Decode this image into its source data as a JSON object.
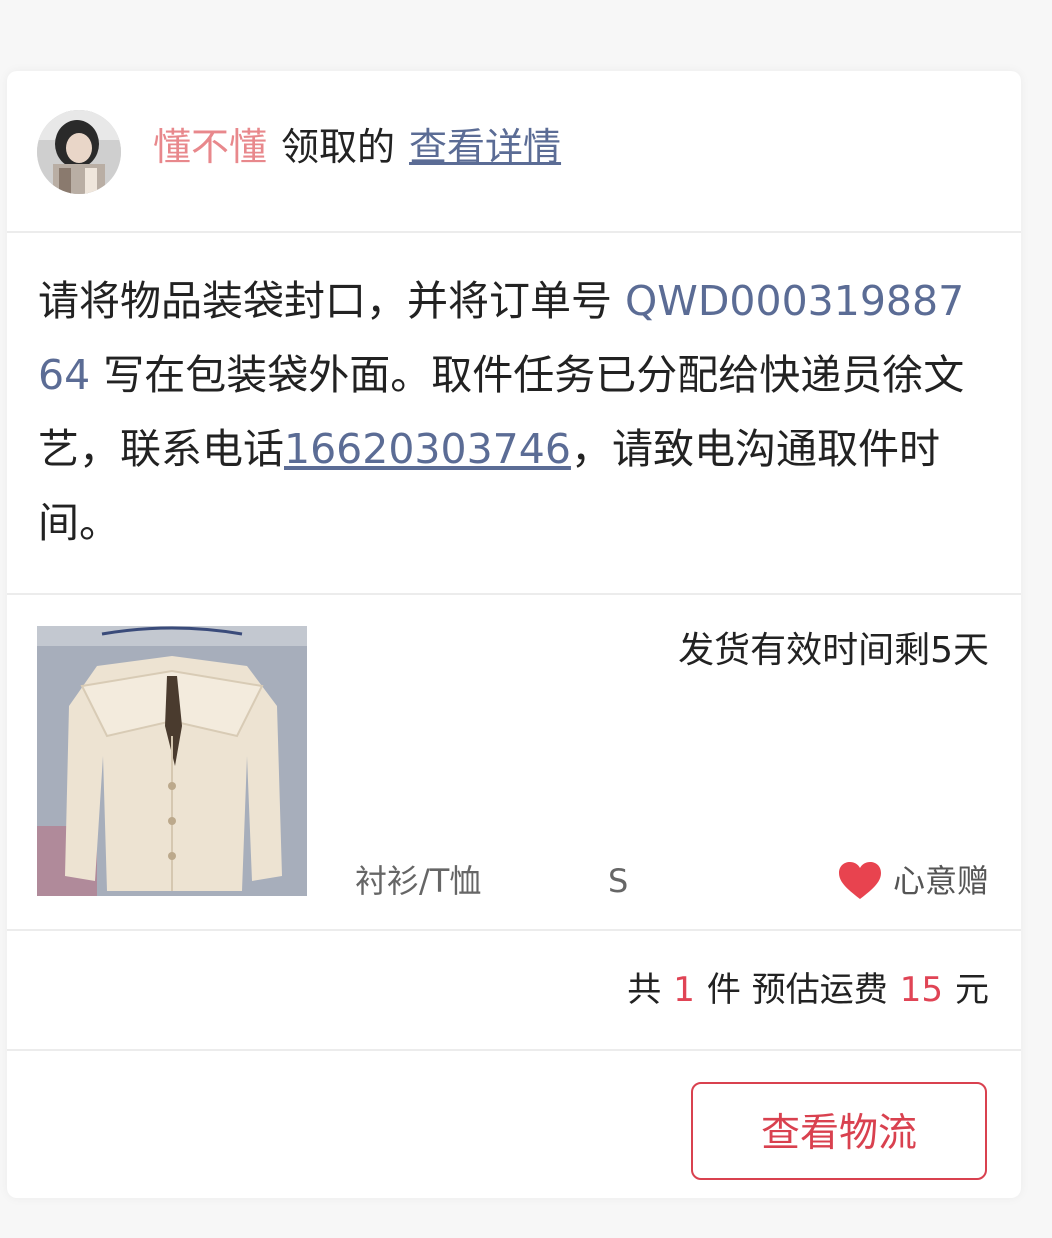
{
  "header": {
    "nickname": "懂不懂",
    "claim_text": "领取的",
    "detail_link": "查看详情"
  },
  "instructions": {
    "text_before_order": "请将物品装袋封口，并将订单号 ",
    "order_number": "QWD00031988764",
    "text_after_order": " 写在包装袋外面。取件任务已分配给快递员徐文艺，联系电话",
    "phone": "16620303746",
    "text_end": "，请致电沟通取件时间。"
  },
  "product": {
    "ship_time": "发货有效时间剩5天",
    "category": "衬衫/T恤",
    "size": "S",
    "gift_label": "心意赠"
  },
  "summary": {
    "prefix": "共",
    "count": "1",
    "middle": "件 预估运费",
    "fee": "15",
    "suffix": "元"
  },
  "actions": {
    "logistics_button": "查看物流"
  },
  "colors": {
    "accent_red": "#d9414f",
    "link_blue": "#5b6c95",
    "nickname_pink": "#e8888c",
    "heart_red": "#e8434f"
  },
  "icons": {
    "gift": "heart-icon"
  }
}
